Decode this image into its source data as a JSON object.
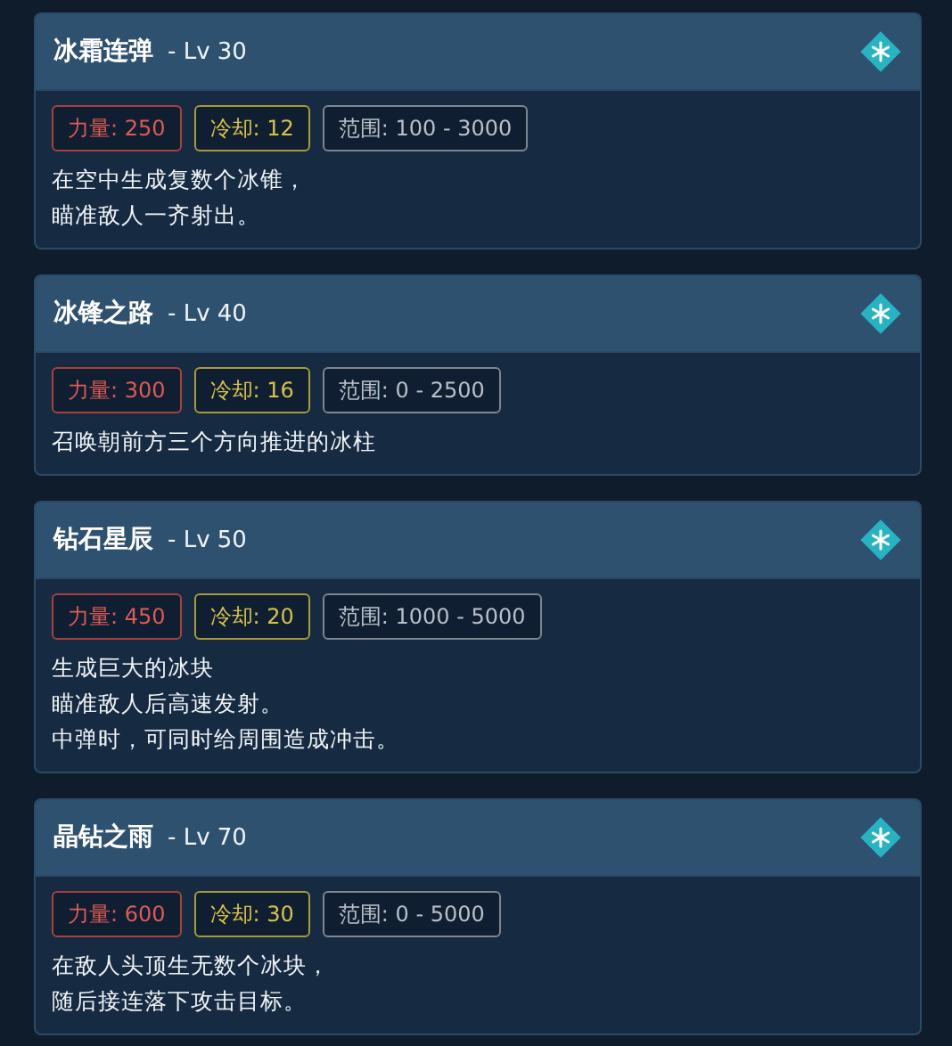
{
  "skills": [
    {
      "name": "冰霜连弹",
      "level": "- Lv 30",
      "stats": [
        {
          "kind": "power",
          "text": "力量: 250"
        },
        {
          "kind": "cooldown",
          "text": "冷却: 12"
        },
        {
          "kind": "range",
          "text": "范围: 100 - 3000"
        }
      ],
      "description": [
        "在空中生成复数个冰锥，",
        "瞄准敌人一齐射出。"
      ]
    },
    {
      "name": "冰锋之路",
      "level": "- Lv 40",
      "stats": [
        {
          "kind": "power",
          "text": "力量: 300"
        },
        {
          "kind": "cooldown",
          "text": "冷却: 16"
        },
        {
          "kind": "range",
          "text": "范围: 0 - 2500"
        }
      ],
      "description": [
        "召唤朝前方三个方向推进的冰柱"
      ]
    },
    {
      "name": "钻石星辰",
      "level": "- Lv 50",
      "stats": [
        {
          "kind": "power",
          "text": "力量: 450"
        },
        {
          "kind": "cooldown",
          "text": "冷却: 20"
        },
        {
          "kind": "range",
          "text": "范围: 1000 - 5000"
        }
      ],
      "description": [
        "生成巨大的冰块",
        "瞄准敌人后高速发射。",
        "中弹时，可同时给周围造成冲击。"
      ]
    },
    {
      "name": "晶钻之雨",
      "level": "- Lv 70",
      "stats": [
        {
          "kind": "power",
          "text": "力量: 600"
        },
        {
          "kind": "cooldown",
          "text": "冷却: 30"
        },
        {
          "kind": "range",
          "text": "范围: 0 - 5000"
        }
      ],
      "description": [
        "在敌人头顶生无数个冰块，",
        "随后接连落下攻击目标。"
      ]
    }
  ]
}
